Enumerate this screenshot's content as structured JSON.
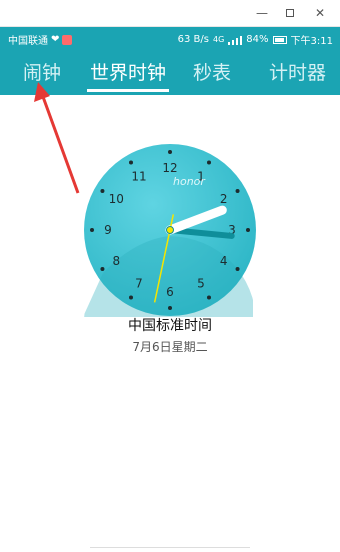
{
  "status": {
    "carrier": "中国联通",
    "speed": "63 B/s",
    "network": "4G",
    "battery": "84%",
    "time": "下午3:11"
  },
  "tabs": [
    {
      "label": "闹钟"
    },
    {
      "label": "世界时钟"
    },
    {
      "label": "秒表"
    },
    {
      "label": "计时器"
    }
  ],
  "clock": {
    "brand": "honor",
    "numbers": [
      "12",
      "1",
      "2",
      "3",
      "4",
      "5",
      "6",
      "7",
      "8",
      "9",
      "10",
      "11"
    ],
    "hour": 3,
    "minute": 11,
    "second": 32
  },
  "world_clock": {
    "city": "中国标准时间",
    "date": "7月6日星期二"
  },
  "colors": {
    "header": "#1ba4b3",
    "clock_face": "#3ec3d3",
    "accent_hand": "#0f8e9a",
    "second_hand": "#f5e600",
    "annotation_arrow": "#e53935"
  }
}
